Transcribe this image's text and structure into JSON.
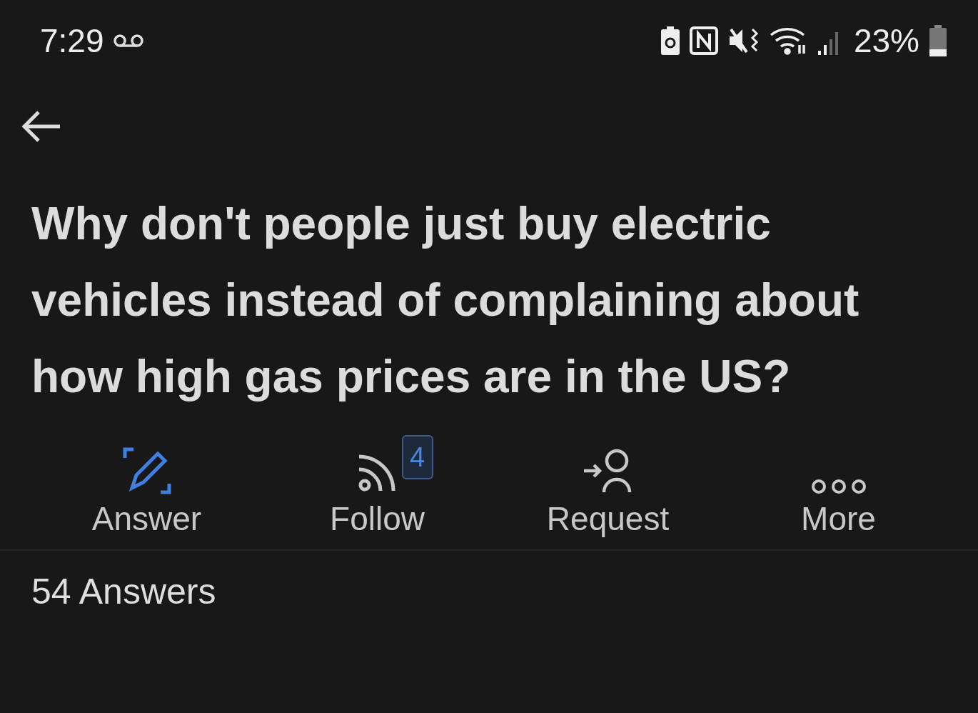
{
  "status_bar": {
    "time": "7:29",
    "battery_text": "23%"
  },
  "question": {
    "title": "Why don't people just buy electric vehicles instead of complaining about how high gas prices are in the US?"
  },
  "actions": [
    {
      "kind": "answer",
      "label": "Answer"
    },
    {
      "kind": "follow",
      "label": "Follow",
      "badge": "4"
    },
    {
      "kind": "request",
      "label": "Request"
    },
    {
      "kind": "more",
      "label": "More"
    }
  ],
  "answers_header": "54 Answers"
}
